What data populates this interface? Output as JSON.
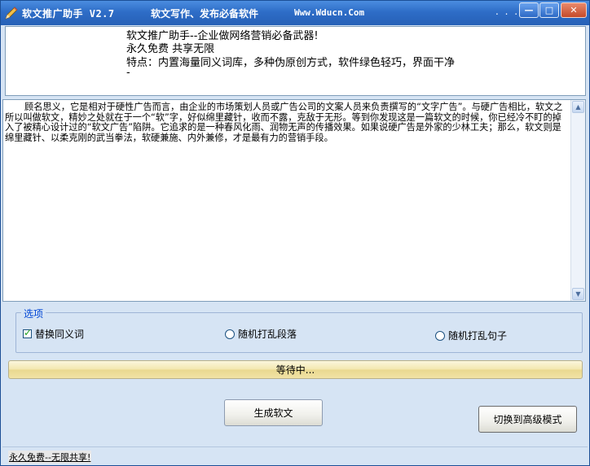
{
  "titlebar": {
    "title": "软文推广助手 V2.7",
    "slogan": "软文写作、发布必备软件",
    "site": "Www.Wducn.Com",
    "dots": ". . .",
    "min_label": "—",
    "max_label": "□",
    "close_label": "✕"
  },
  "info": {
    "line1": "软文推广助手--企业做网络营销必备武器!",
    "line2": "永久免费 共享无限",
    "line3": "特点：内置海量同义词库，多种伪原创方式，软件绿色轻巧，界面干净",
    "line4": "-"
  },
  "article": {
    "text": "顾名思义，它是相对于硬性广告而言，由企业的市场策划人员或广告公司的文案人员来负责撰写的“文字广告”。与硬广告相比，软文之所以叫做软文，精妙之处就在于一个“软”字，好似绵里藏针，收而不露，克敌于无形。等到你发现这是一篇软文的时候，你已经冷不盯的掉入了被精心设计过的“软文广告”陷阱。它追求的是一种春风化雨、润物无声的传播效果。如果说硬广告是外家的少林工夫；那么，软文则是绵里藏针、以柔克刚的武当拳法，软硬兼施、内外兼修，才是最有力的营销手段。",
    "scroll_up": "▲",
    "scroll_down": "▼"
  },
  "options": {
    "legend": "选项",
    "opt_synonym": "替换同义词",
    "opt_synonym_checked": true,
    "opt_paragraph": "随机打乱段落",
    "opt_sentence": "随机打乱句子"
  },
  "progress": {
    "label": "等待中...",
    "value": 0
  },
  "buttons": {
    "generate": "生成软文",
    "advanced": "切换到高级模式"
  },
  "status": {
    "text": "永久免费--无限共享!"
  },
  "colors": {
    "titlebar": "#2e6dc7",
    "window_bg": "#d6e4f4",
    "legend_text": "#0046d5",
    "check_mark": "#21a121"
  }
}
